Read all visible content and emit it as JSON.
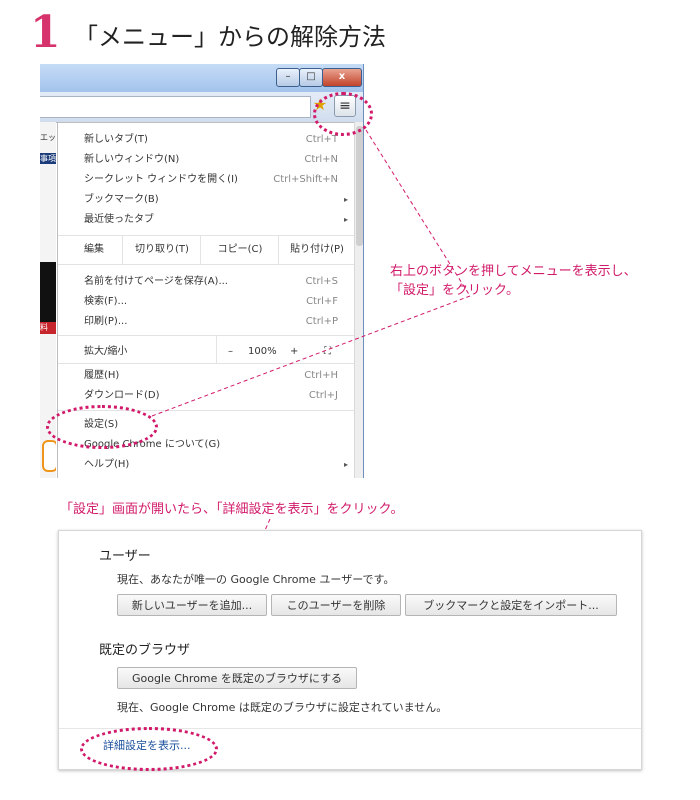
{
  "heading": {
    "step": "1",
    "title": "「メニュー」からの解除方法"
  },
  "browser": {
    "window_buttons": {
      "minimize": "–",
      "maximize": "□",
      "close": "x"
    },
    "star_icon": "star-icon",
    "menu_icon": "≡",
    "page_strip": {
      "t1": "エッ",
      "t2": "事項",
      "t3": "料"
    },
    "menu": {
      "new_tab": {
        "label": "新しいタブ(T)",
        "shortcut": "Ctrl+T"
      },
      "new_window": {
        "label": "新しいウィンドウ(N)",
        "shortcut": "Ctrl+N"
      },
      "incognito": {
        "label": "シークレット ウィンドウを開く(I)",
        "shortcut": "Ctrl+Shift+N"
      },
      "bookmarks": {
        "label": "ブックマーク(B)"
      },
      "recent_tabs": {
        "label": "最近使ったタブ"
      },
      "edit": {
        "label": "編集",
        "cut": "切り取り(T)",
        "copy": "コピー(C)",
        "paste": "貼り付け(P)"
      },
      "save_as": {
        "label": "名前を付けてページを保存(A)...",
        "shortcut": "Ctrl+S"
      },
      "find": {
        "label": "検索(F)...",
        "shortcut": "Ctrl+F"
      },
      "print": {
        "label": "印刷(P)...",
        "shortcut": "Ctrl+P"
      },
      "zoom": {
        "label": "拡大/縮小",
        "minus": "–",
        "value": "100%",
        "plus": "+",
        "fullscreen": "⛶"
      },
      "history": {
        "label": "履歴(H)",
        "shortcut": "Ctrl+H"
      },
      "downloads": {
        "label": "ダウンロード(D)",
        "shortcut": "Ctrl+J"
      },
      "settings": {
        "label": "設定(S)"
      },
      "about": {
        "label": "Google Chrome について(G)"
      },
      "help": {
        "label": "ヘルプ(H)"
      }
    }
  },
  "annotations": {
    "note_1_line1": "右上のボタンを押してメニューを表示し、",
    "note_1_line2": "「設定」をクリック。",
    "note_2": "「設定」画面が開いたら、「詳細設定を表示」をクリック。"
  },
  "settings": {
    "users": {
      "title": "ユーザー",
      "desc": "現在、あなたが唯一の Google Chrome ユーザーです。",
      "add_user": "新しいユーザーを追加...",
      "delete_user": "このユーザーを削除",
      "import": "ブックマークと設定をインポート..."
    },
    "default_browser": {
      "title": "既定のブラウザ",
      "make_default": "Google Chrome を既定のブラウザにする",
      "desc": "現在、Google Chrome は既定のブラウザに設定されていません。"
    },
    "advanced_link": "詳細設定を表示..."
  },
  "colors": {
    "accent": "#d11a6a",
    "heading_number": "#d6336c",
    "link": "#1a4f9c"
  }
}
